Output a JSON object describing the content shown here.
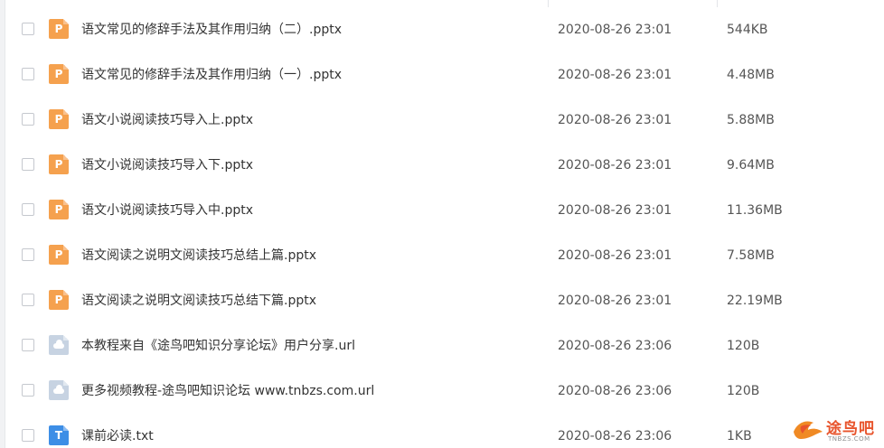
{
  "files": [
    {
      "name": "语文常见的修辞手法及其作用归纳（二）.pptx",
      "type": "pptx",
      "icon": "pptx-file-icon",
      "modified": "2020-08-26 23:01",
      "size": "544KB"
    },
    {
      "name": "语文常见的修辞手法及其作用归纳（一）.pptx",
      "type": "pptx",
      "icon": "pptx-file-icon",
      "modified": "2020-08-26 23:01",
      "size": "4.48MB"
    },
    {
      "name": "语文小说阅读技巧导入上.pptx",
      "type": "pptx",
      "icon": "pptx-file-icon",
      "modified": "2020-08-26 23:01",
      "size": "5.88MB"
    },
    {
      "name": "语文小说阅读技巧导入下.pptx",
      "type": "pptx",
      "icon": "pptx-file-icon",
      "modified": "2020-08-26 23:01",
      "size": "9.64MB"
    },
    {
      "name": "语文小说阅读技巧导入中.pptx",
      "type": "pptx",
      "icon": "pptx-file-icon",
      "modified": "2020-08-26 23:01",
      "size": "11.36MB"
    },
    {
      "name": "语文阅读之说明文阅读技巧总结上篇.pptx",
      "type": "pptx",
      "icon": "pptx-file-icon",
      "modified": "2020-08-26 23:01",
      "size": "7.58MB"
    },
    {
      "name": "语文阅读之说明文阅读技巧总结下篇.pptx",
      "type": "pptx",
      "icon": "pptx-file-icon",
      "modified": "2020-08-26 23:01",
      "size": "22.19MB"
    },
    {
      "name": "本教程来自《途鸟吧知识分享论坛》用户分享.url",
      "type": "url",
      "icon": "url-file-icon",
      "modified": "2020-08-26 23:06",
      "size": "120B"
    },
    {
      "name": "更多视频教程-途鸟吧知识论坛 www.tnbzs.com.url",
      "type": "url",
      "icon": "url-file-icon",
      "modified": "2020-08-26 23:06",
      "size": "120B"
    },
    {
      "name": "课前必读.txt",
      "type": "txt",
      "icon": "txt-file-icon",
      "modified": "2020-08-26 23:06",
      "size": "1KB"
    }
  ],
  "watermark": {
    "text": "途鸟吧",
    "domain": "TNBZS.COM",
    "color": "#e8542c"
  },
  "colors": {
    "pptx": "#f5a14e",
    "url": "#c7d3e2",
    "txt": "#3d8ee6"
  }
}
